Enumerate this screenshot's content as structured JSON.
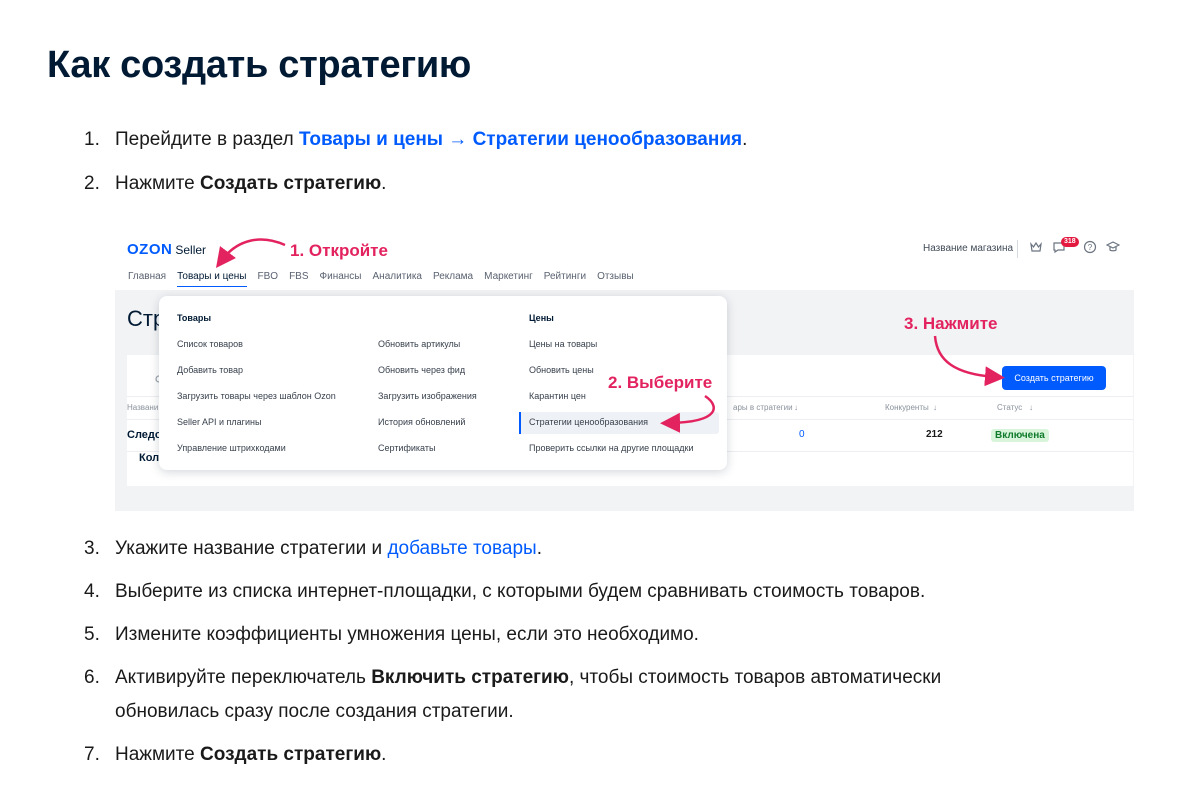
{
  "heading": "Как создать стратегию",
  "steps": [
    {
      "num": "1.",
      "parts": [
        "Перейдите в раздел ",
        "Товары и цены → Стратегии ценообразования",
        "."
      ]
    },
    {
      "num": "2.",
      "parts": [
        "Нажмите ",
        "Создать стратегию",
        "."
      ]
    },
    {
      "num": "3.",
      "parts": [
        "Укажите название стратегии и ",
        "добавьте товары",
        "."
      ]
    },
    {
      "num": "4.",
      "text": "Выберите из списка интернет-площадки, с которыми будем сравнивать стоимость товаров."
    },
    {
      "num": "5.",
      "text": "Измените коэффициенты умножения цены, если это необходимо."
    },
    {
      "num": "6.",
      "parts": [
        "Активируйте переключатель ",
        "Включить стратегию",
        ", чтобы стоимость товаров автоматически"
      ],
      "line2": "обновилась сразу после создания стратегии."
    },
    {
      "num": "7.",
      "parts": [
        "Нажмите ",
        "Создать стратегию",
        "."
      ]
    }
  ],
  "screenshot": {
    "logo": "OZON",
    "logo_suffix": "Seller",
    "nav": [
      "Главная",
      "Товары и цены",
      "FBO",
      "FBS",
      "Финансы",
      "Аналитика",
      "Реклама",
      "Маркетинг",
      "Рейтинги",
      "Отзывы"
    ],
    "store_name": "Название магазина",
    "notif_badge": "318",
    "page_title": "Стр",
    "menu": {
      "col1_header": "Товары",
      "col1": [
        "Список товаров",
        "Добавить товар",
        "Загрузить товары через шаблон Ozon",
        "Seller API и плагины",
        "Управление штрихкодами"
      ],
      "col2": [
        "Обновить артикулы",
        "Обновить через фид",
        "Загрузить изображения",
        "История обновлений",
        "Сертификаты"
      ],
      "col3_header": "Цены",
      "col3": [
        "Цены на товары",
        "Обновить цены",
        "Карантин цен",
        "Стратегии ценообразования",
        "Проверить ссылки на другие площадки"
      ]
    },
    "table": {
      "col_name": "Названи",
      "col_in_strategy": "ары в стратегии",
      "col_competitors": "Конкуренты",
      "col_status": "Статус",
      "row_name": "Следо",
      "row_count": "0",
      "row_competitors": "212",
      "row_status": "Включена",
      "row2": "Кол"
    },
    "create_button": "Создать стратегию",
    "annotations": {
      "open": "1. Откройте",
      "select": "2. Выберите",
      "click": "3. Нажмите"
    }
  }
}
